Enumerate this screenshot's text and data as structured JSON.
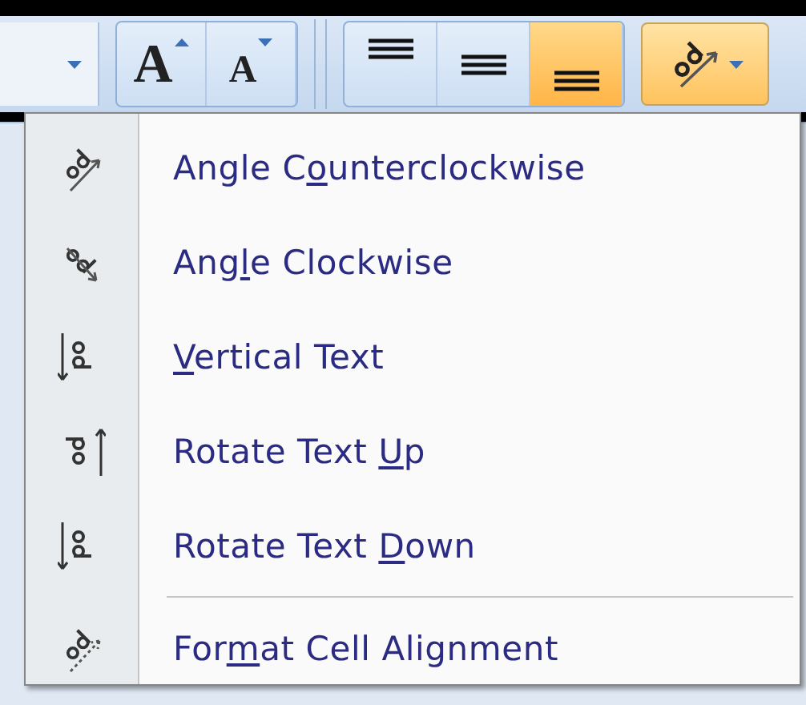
{
  "toolbar": {
    "font_size_buttons": [
      {
        "label": "A",
        "kind": "grow"
      },
      {
        "label": "A",
        "kind": "shrink"
      }
    ],
    "align_buttons": [
      {
        "kind": "top",
        "selected": false
      },
      {
        "kind": "middle",
        "selected": false
      },
      {
        "kind": "bottom",
        "selected": true
      }
    ],
    "orientation_button": {
      "selected": true
    }
  },
  "menu": {
    "sections": [
      {
        "items": [
          {
            "kind": "angle-ccw",
            "label": [
              "Angle C",
              "o",
              "unterclockwise"
            ]
          },
          {
            "kind": "angle-cw",
            "label": [
              "Ang",
              "l",
              "e Clockwise"
            ]
          },
          {
            "kind": "vertical",
            "label": [
              "V",
              "ertical Text"
            ]
          },
          {
            "kind": "up",
            "label": [
              "Rotate Text ",
              "U",
              "p"
            ]
          },
          {
            "kind": "down",
            "label": [
              "Rotate Text ",
              "D",
              "own"
            ]
          }
        ]
      },
      {
        "items": [
          {
            "kind": "format",
            "label": [
              "For",
              "m",
              "at Cell Alignment"
            ]
          }
        ]
      }
    ]
  }
}
